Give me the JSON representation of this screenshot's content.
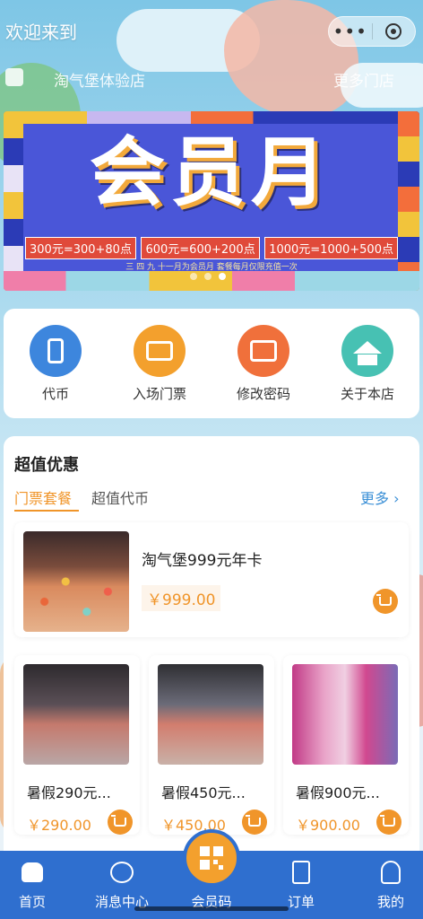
{
  "header": {
    "welcome": "欢迎来到",
    "capsule_more": "•••",
    "store_name": "淘气堡体验店",
    "store_more": "更多门店"
  },
  "banner": {
    "title": "会员月",
    "prices": [
      "300元=300+80点",
      "600元=600+200点",
      "1000元=1000+500点"
    ],
    "subtitle": "三 四 九   十一月为会员月 套餐每月仅限充值一次",
    "dots": 3,
    "active_dot": 2
  },
  "quick_menu": [
    {
      "label": "代币",
      "icon": "phone-icon",
      "color": "#3d86dd"
    },
    {
      "label": "入场门票",
      "icon": "ticket-icon",
      "color": "#f3a02d"
    },
    {
      "label": "修改密码",
      "icon": "id-card-icon",
      "color": "#f0703b"
    },
    {
      "label": "关于本店",
      "icon": "house-icon",
      "color": "#47c1b3"
    }
  ],
  "deals": {
    "title": "超值优惠",
    "tabs": [
      "门票套餐",
      "超值代币"
    ],
    "active_tab": 0,
    "more": "更多 ›",
    "featured": {
      "title": "淘气堡999元年卡",
      "price": "￥999.00"
    },
    "items": [
      {
        "title": "暑假290元...",
        "price": "￥290.00"
      },
      {
        "title": "暑假450元...",
        "price": "￥450.00"
      },
      {
        "title": "暑假900元...",
        "price": "￥900.00"
      }
    ]
  },
  "tabbar": {
    "items": [
      {
        "label": "首页",
        "icon": "home-icon"
      },
      {
        "label": "消息中心",
        "icon": "chat-icon"
      },
      {
        "label": "会员码",
        "icon": "qr-code-icon"
      },
      {
        "label": "订单",
        "icon": "order-icon"
      },
      {
        "label": "我的",
        "icon": "user-icon"
      }
    ],
    "active": 0
  },
  "colors": {
    "accent": "#f0952a",
    "tabbar": "#2f6fcf",
    "link": "#3a8fd6"
  }
}
